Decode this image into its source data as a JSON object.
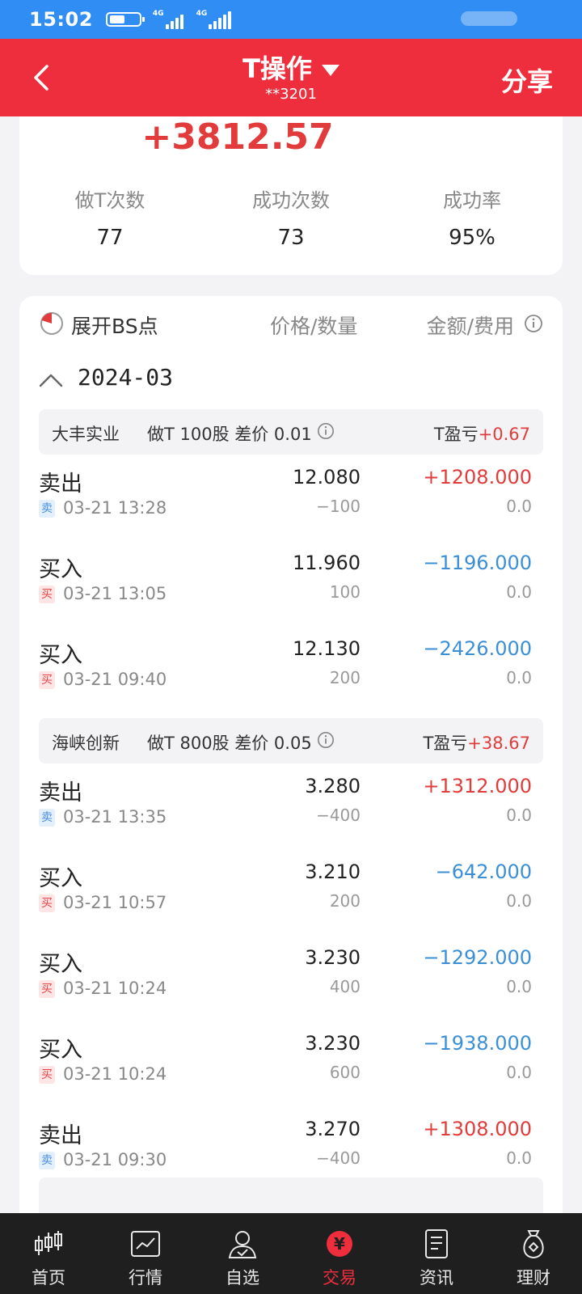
{
  "status_bar": {
    "time": "15:02",
    "network_1": "4G",
    "network_2": "4G"
  },
  "nav": {
    "title": "T操作",
    "account": "**3201",
    "share_label": "分享"
  },
  "summary": {
    "total_profit": "+3812.57",
    "stats": [
      {
        "label": "做T次数",
        "value": "77"
      },
      {
        "label": "成功次数",
        "value": "73"
      },
      {
        "label": "成功率",
        "value": "95%"
      }
    ]
  },
  "records": {
    "expand_label": "展开BS点",
    "col_price_qty": "价格/数量",
    "col_amount_fee": "金额/费用",
    "month": "2024-03",
    "groups": [
      {
        "name": "大丰实业",
        "desc": "做T 100股 差价 0.01",
        "pl_label": "T盈亏",
        "pl_value": "+0.67",
        "trades": [
          {
            "direction": "卖出",
            "badge": "卖",
            "side": "sell",
            "time": "03-21 13:28",
            "price": "12.080",
            "qty": "−100",
            "amount": "+1208.000",
            "fee": "0.0"
          },
          {
            "direction": "买入",
            "badge": "买",
            "side": "buy",
            "time": "03-21 13:05",
            "price": "11.960",
            "qty": "100",
            "amount": "−1196.000",
            "fee": "0.0"
          },
          {
            "direction": "买入",
            "badge": "买",
            "side": "buy",
            "time": "03-21 09:40",
            "price": "12.130",
            "qty": "200",
            "amount": "−2426.000",
            "fee": "0.0"
          }
        ]
      },
      {
        "name": "海峡创新",
        "desc": "做T 800股 差价 0.05",
        "pl_label": "T盈亏",
        "pl_value": "+38.67",
        "trades": [
          {
            "direction": "卖出",
            "badge": "卖",
            "side": "sell",
            "time": "03-21 13:35",
            "price": "3.280",
            "qty": "−400",
            "amount": "+1312.000",
            "fee": "0.0"
          },
          {
            "direction": "买入",
            "badge": "买",
            "side": "buy",
            "time": "03-21 10:57",
            "price": "3.210",
            "qty": "200",
            "amount": "−642.000",
            "fee": "0.0"
          },
          {
            "direction": "买入",
            "badge": "买",
            "side": "buy",
            "time": "03-21 10:24",
            "price": "3.230",
            "qty": "400",
            "amount": "−1292.000",
            "fee": "0.0"
          },
          {
            "direction": "买入",
            "badge": "买",
            "side": "buy",
            "time": "03-21 10:24",
            "price": "3.230",
            "qty": "600",
            "amount": "−1938.000",
            "fee": "0.0"
          },
          {
            "direction": "卖出",
            "badge": "卖",
            "side": "sell",
            "time": "03-21 09:30",
            "price": "3.270",
            "qty": "−400",
            "amount": "+1308.000",
            "fee": "0.0"
          }
        ]
      }
    ]
  },
  "tabs": [
    {
      "label": "首页",
      "icon": "candlestick-icon"
    },
    {
      "label": "行情",
      "icon": "chart-icon"
    },
    {
      "label": "自选",
      "icon": "user-check-icon"
    },
    {
      "label": "交易",
      "icon": "yuan-icon",
      "active": true
    },
    {
      "label": "资讯",
      "icon": "document-icon"
    },
    {
      "label": "理财",
      "icon": "money-bag-icon"
    }
  ],
  "colors": {
    "brand_red": "#ee2e3c",
    "status_blue": "#2f8df3",
    "profit_red": "#e23b3b",
    "loss_blue": "#3b8fd6"
  }
}
